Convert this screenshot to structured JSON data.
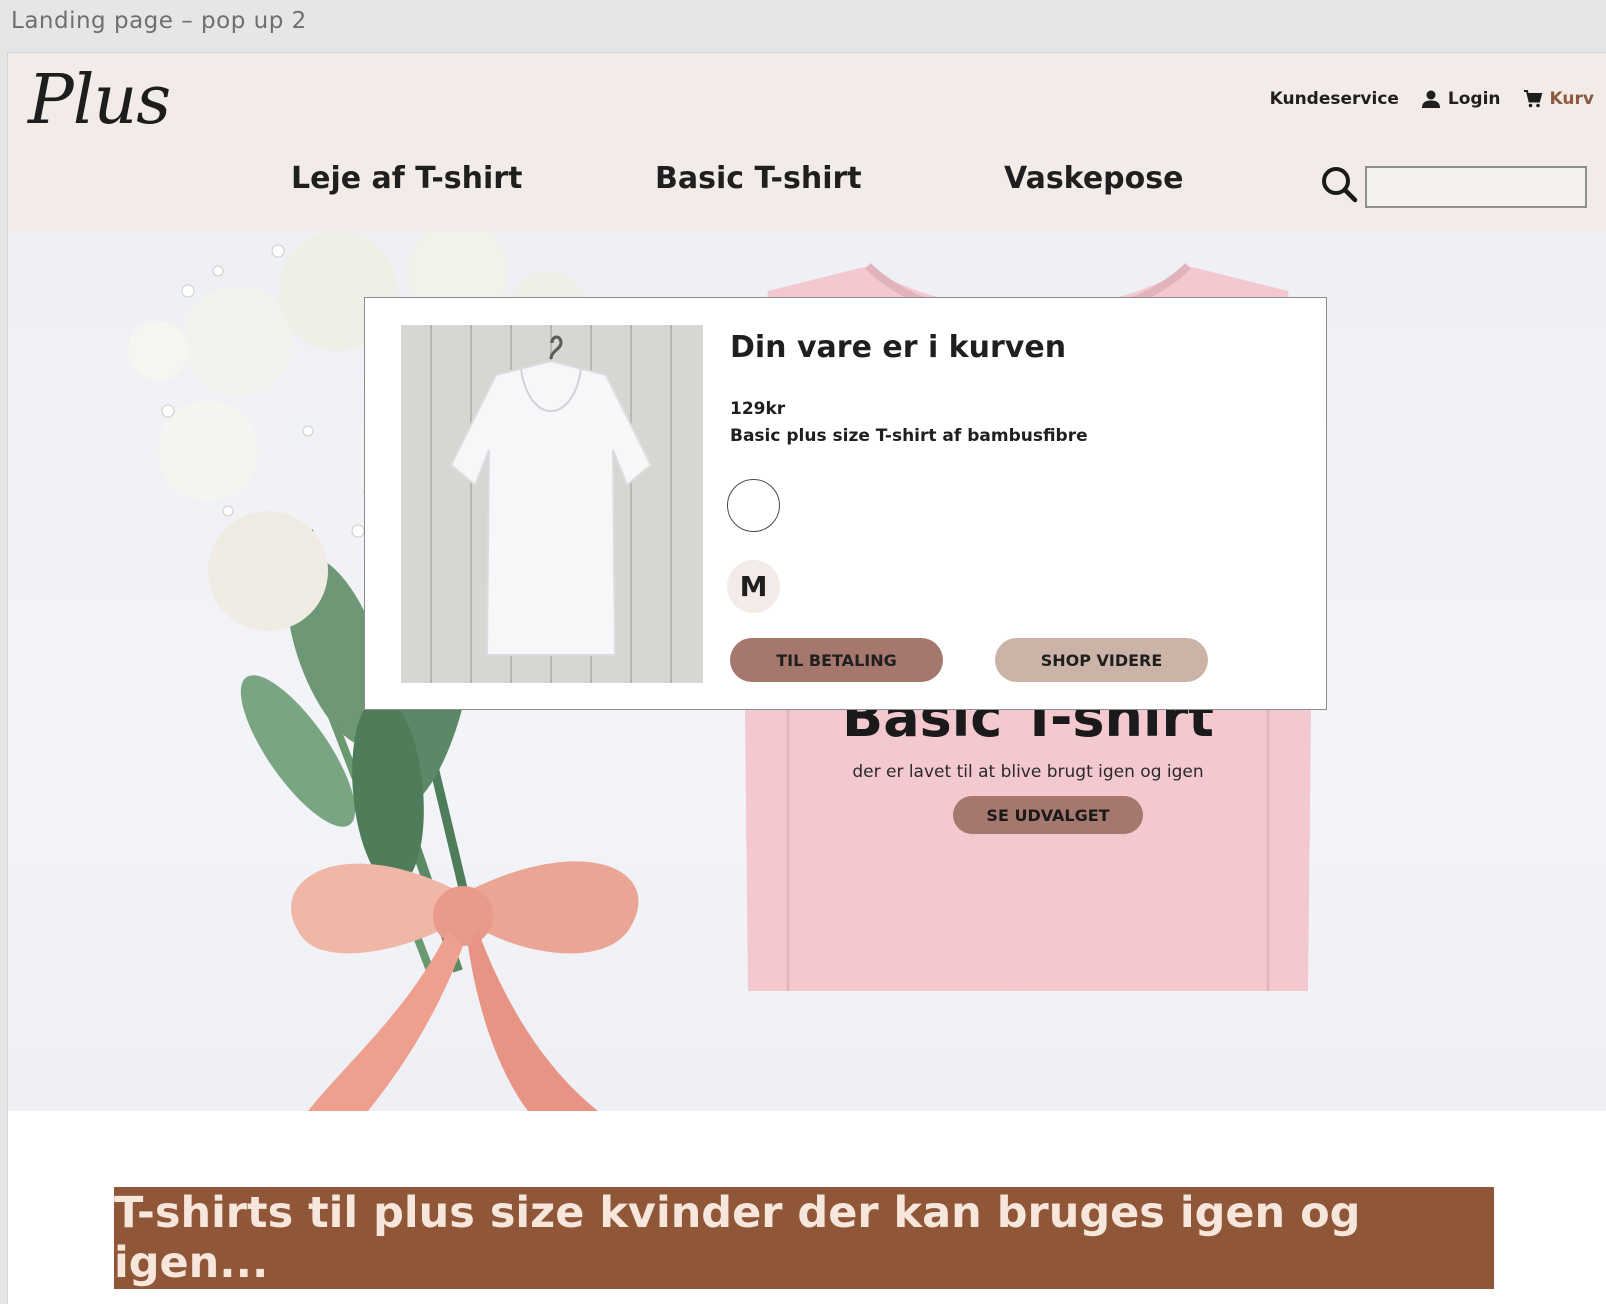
{
  "frame": {
    "label": "Landing page – pop up 2"
  },
  "header": {
    "logo_text": "Plus",
    "util_nav": [
      {
        "label": "Kundeservice",
        "icon": ""
      },
      {
        "label": "Login",
        "icon": "user-icon"
      },
      {
        "label": "Kurv",
        "icon": "cart-icon"
      }
    ],
    "main_nav": [
      "Leje af T-shirt",
      "Basic T-shirt",
      "Vaskepose"
    ],
    "search": {
      "placeholder": "",
      "value": ""
    }
  },
  "hero": {
    "title": "Basic T-shirt",
    "subtitle": "der er lavet til at blive brugt igen og igen",
    "button_label": "SE UDVALGET"
  },
  "banner": {
    "text": "T-shirts til plus size kvinder der kan bruges igen og igen..."
  },
  "popup": {
    "title": "Din vare er i kurven",
    "price": "129kr",
    "description": "Basic plus size T-shirt af bambusfibre",
    "color_swatch": "#ffffff",
    "size": "M",
    "button_pay": "TIL BETALING",
    "button_shop": "SHOP VIDERE"
  },
  "colors": {
    "header_bg": "#f3ebe7",
    "banner_bg": "#8f5637",
    "accent_button": "#a6776c",
    "secondary_button": "#cbb3a7",
    "cart_link": "#8a5a3e"
  }
}
